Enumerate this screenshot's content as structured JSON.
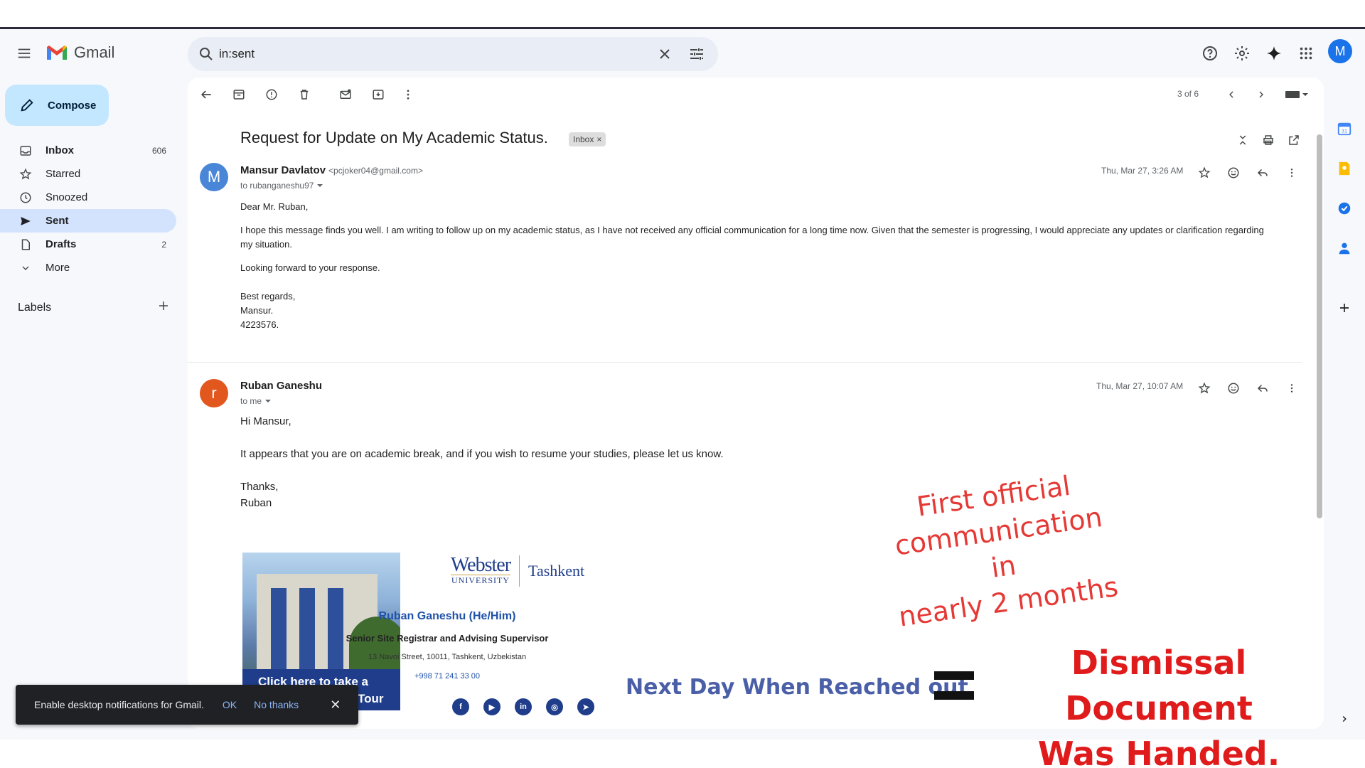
{
  "header": {
    "app_name": "Gmail",
    "search_value": "in:sent",
    "avatar_letter": "M"
  },
  "sidebar": {
    "compose_label": "Compose",
    "items": [
      {
        "label": "Inbox",
        "count": "606"
      },
      {
        "label": "Starred",
        "count": ""
      },
      {
        "label": "Snoozed",
        "count": ""
      },
      {
        "label": "Sent",
        "count": ""
      },
      {
        "label": "Drafts",
        "count": "2"
      },
      {
        "label": "More",
        "count": ""
      }
    ],
    "labels_heading": "Labels"
  },
  "toolbar": {
    "pager": "3 of 6"
  },
  "thread": {
    "subject": "Request for Update on My Academic Status.",
    "chip": "Inbox",
    "messages": [
      {
        "avatar": "M",
        "avatar_color": "#4a86d8",
        "sender": "Mansur Davlatov",
        "email": "<pcjoker04@gmail.com>",
        "to": "to rubanganeshu97",
        "date": "Thu, Mar 27, 3:26 AM",
        "body": [
          "Dear Mr. Ruban,",
          "I hope this message finds you well. I am writing to follow up on my academic status, as I have not received any official communication for a long time now. Given that the semester is progressing, I would appreciate any updates or clarification regarding my situation.",
          "Looking forward to your response."
        ],
        "closing": [
          "Best regards,",
          "Mansur.",
          "4223576."
        ]
      },
      {
        "avatar": "r",
        "avatar_color": "#e2571e",
        "sender": "Ruban Ganeshu",
        "to": "to me",
        "date": "Thu, Mar 27, 10:07 AM",
        "body": [
          "Hi Mansur,",
          "It appears that you are on academic break, and if you wish to resume your studies, please let us know."
        ],
        "closing": [
          "Thanks,",
          "Ruban"
        ]
      }
    ]
  },
  "signature": {
    "banner_line1": "Click here to take a",
    "banner_line2": "Tour",
    "logo_webster": "Webster",
    "logo_university": "UNIVERSITY",
    "logo_city": "Tashkent",
    "name": "Ruban Ganeshu (He/Him)",
    "title": "Senior Site Registrar and Advising Supervisor",
    "address": "13 Navoi Street, 10011, Tashkent, Uzbekistan",
    "phone": "+998 71 241 33 00",
    "social": [
      "f",
      "▶",
      "in",
      "◎",
      "➤"
    ]
  },
  "toast": {
    "message": "Enable desktop notifications for Gmail.",
    "ok": "OK",
    "no_thanks": "No thanks"
  },
  "annotations": {
    "red_note_line1": "First official",
    "red_note_line2": "communication in",
    "red_note_line3": "nearly 2 months",
    "next_day": "Next Day When Reached out",
    "dismissal_line1": "Dismissal Document",
    "dismissal_line2": "Was Handed."
  }
}
